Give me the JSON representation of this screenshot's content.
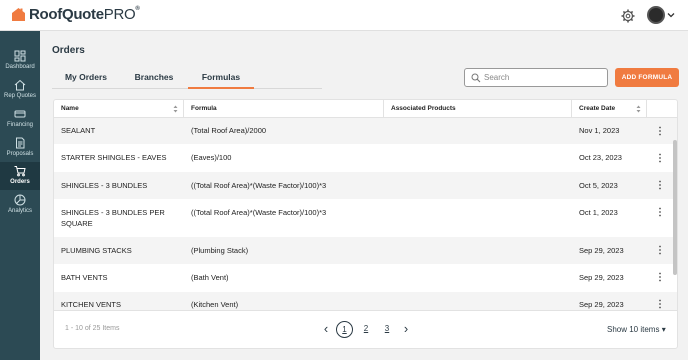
{
  "app": {
    "logo_text_bold": "RoofQuote",
    "logo_text_light": "PRO",
    "logo_mark": "®"
  },
  "sidebar": {
    "items": [
      {
        "label": "Dashboard",
        "icon": "dashboard-icon"
      },
      {
        "label": "Rep Quotes",
        "icon": "house-icon"
      },
      {
        "label": "Financing",
        "icon": "truck-icon"
      },
      {
        "label": "Proposals",
        "icon": "document-icon"
      },
      {
        "label": "Orders",
        "icon": "cart-icon",
        "active": true
      },
      {
        "label": "Analytics",
        "icon": "pie-chart-icon"
      }
    ]
  },
  "page": {
    "title": "Orders"
  },
  "tabs": [
    {
      "label": "My Orders",
      "active": false
    },
    {
      "label": "Branches",
      "active": false
    },
    {
      "label": "Formulas",
      "active": true
    }
  ],
  "search": {
    "placeholder": "Search",
    "value": ""
  },
  "add_button": {
    "label": "ADD FORMULA"
  },
  "table": {
    "columns": [
      "Name",
      "Formula",
      "Associated Products",
      "Create Date"
    ],
    "rows": [
      {
        "name": "SEALANT",
        "name2": "",
        "formula": "(Total Roof Area)/2000",
        "products": "",
        "date": "Nov 1, 2023"
      },
      {
        "name": "STARTER SHINGLES - EAVES",
        "name2": "",
        "formula": "(Eaves)/100",
        "products": "",
        "date": "Oct 23, 2023"
      },
      {
        "name": "SHINGLES - 3 BUNDLES",
        "name2": "",
        "formula": "((Total Roof Area)*(Waste Factor)/100)*3",
        "products": "",
        "date": "Oct 5, 2023"
      },
      {
        "name": "SHINGLES - 3 BUNDLES PER",
        "name2": "SQUARE",
        "formula": "((Total Roof Area)*(Waste Factor)/100)*3",
        "products": "",
        "date": "Oct 1, 2023"
      },
      {
        "name": "PLUMBING STACKS",
        "name2": "",
        "formula": "(Plumbing Stack)",
        "products": "",
        "date": "Sep 29, 2023"
      },
      {
        "name": "BATH VENTS",
        "name2": "",
        "formula": "(Bath Vent)",
        "products": "",
        "date": "Sep 29, 2023"
      },
      {
        "name": "KITCHEN VENTS",
        "name2": "",
        "formula": "(Kitchen Vent)",
        "products": "",
        "date": "Sep 29, 2023"
      }
    ]
  },
  "pagination": {
    "range_text": "1 - 10 of 25 Items",
    "pages": [
      "1",
      "2",
      "3"
    ],
    "current_page": "1",
    "prev": "‹",
    "next": "›",
    "show_label": "Show 10 items ▾"
  },
  "colors": {
    "accent": "#f07b40",
    "sidebar": "#2c4a54",
    "sidebar_active": "#1f3942",
    "text_dark": "#2b3a44"
  }
}
